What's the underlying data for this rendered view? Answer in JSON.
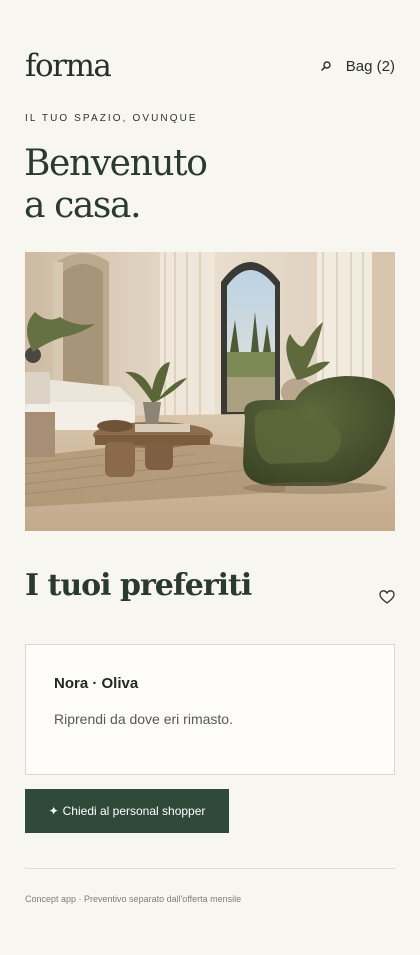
{
  "header": {
    "logo": "forma",
    "search_icon": "search-icon",
    "bag_label": "Bag (2)"
  },
  "hero": {
    "eyebrow": "IL TUO SPAZIO, OVUNQUE",
    "title_line1": "Benvenuto",
    "title_line2": "a casa."
  },
  "favorites": {
    "title": "I tuoi preferiti",
    "heart_icon": "heart-icon",
    "card": {
      "name": "Nora · Oliva",
      "text": "Riprendi da dove eri rimasto."
    }
  },
  "cta": {
    "icon": "sparkle-icon",
    "star": "✦",
    "label": "Chiedi al personal shopper"
  },
  "footer": {
    "text": "Concept app · Preventivo separato dall'offerta mensile"
  },
  "colors": {
    "background": "#f8f6f0",
    "accent": "#2f4a39",
    "text": "#2a3a2e"
  }
}
